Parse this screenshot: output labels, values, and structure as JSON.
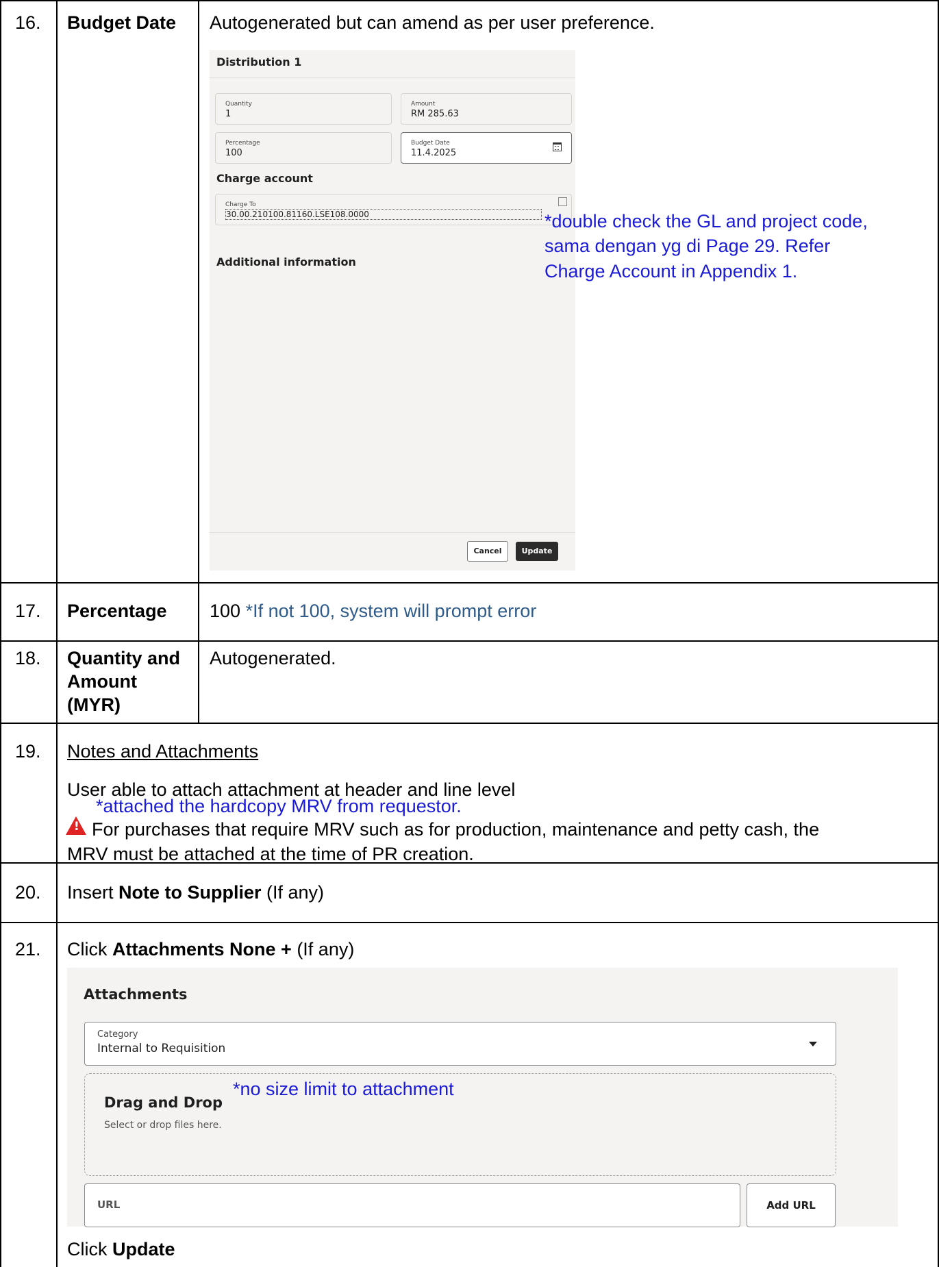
{
  "rows": {
    "r16": {
      "num": "16.",
      "field": "Budget Date",
      "desc": "Autogenerated but can amend as per user preference.",
      "distribution": {
        "title": "Distribution 1",
        "quantity_label": "Quantity",
        "quantity_value": "1",
        "amount_label": "Amount",
        "amount_value": "RM 285.63",
        "percentage_label": "Percentage",
        "percentage_value": "100",
        "budget_date_label": "Budget Date",
        "budget_date_value": "11.4.2025",
        "charge_account_title": "Charge account",
        "charge_to_label": "Charge To",
        "charge_to_value": "30.00.210100.81160.LSE108.0000",
        "additional_info_title": "Additional information",
        "cancel_label": "Cancel",
        "update_label": "Update"
      },
      "annotation": [
        "*double check the GL and project code,",
        "sama dengan yg di Page 29. Refer",
        "Charge Account in Appendix 1."
      ]
    },
    "r17": {
      "num": "17.",
      "field": "Percentage",
      "value": "100",
      "note": "*If not 100, system will prompt error"
    },
    "r18": {
      "num": "18.",
      "field_lines": [
        "Quantity and",
        "Amount",
        "(MYR)"
      ],
      "desc": "Autogenerated."
    },
    "r19": {
      "num": "19.",
      "heading": "Notes and Attachments",
      "desc": "User able to attach attachment at header and line level",
      "annotation": "*attached the hardcopy MRV from requestor.",
      "warning_line1": "For purchases that require MRV such as for production, maintenance and petty cash, the",
      "warning_line2": "MRV must be attached at the time of PR creation."
    },
    "r20": {
      "num": "20.",
      "pre": "Insert ",
      "bold": "Note to Supplier",
      "post": " (If any)"
    },
    "r21": {
      "num": "21.",
      "pre": "Click ",
      "bold": "Attachments None +",
      "post": " (If any)",
      "attachments": {
        "title": "Attachments",
        "category_label": "Category",
        "category_value": "Internal to Requisition",
        "drag_title": "Drag and Drop",
        "drag_hint": "Select or drop files here.",
        "annotation": "*no size limit to attachment",
        "url_placeholder": "URL",
        "add_url_label": "Add URL"
      },
      "final_pre": "Click ",
      "final_bold": "Update"
    }
  }
}
